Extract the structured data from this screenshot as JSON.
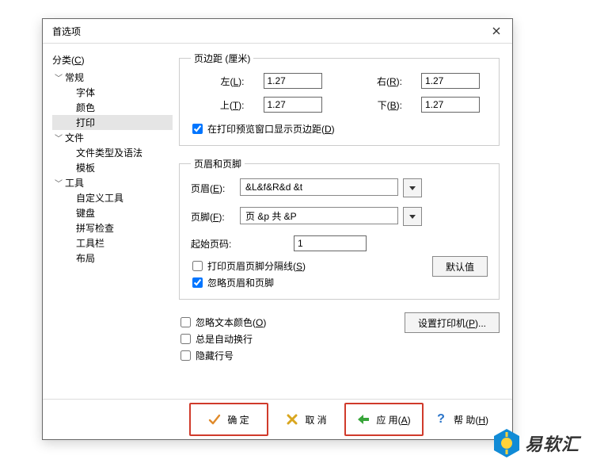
{
  "dialog": {
    "title": "首选项"
  },
  "sidebar": {
    "category_label": "分类(",
    "category_key": "C",
    "category_label_end": ")",
    "groups": [
      {
        "label": "常规",
        "items": [
          "字体",
          "颜色",
          "打印"
        ],
        "selected_index": 2
      },
      {
        "label": "文件",
        "items": [
          "文件类型及语法",
          "模板"
        ],
        "selected_index": -1
      },
      {
        "label": "工具",
        "items": [
          "自定义工具",
          "键盘",
          "拼写检查",
          "工具栏",
          "布局"
        ],
        "selected_index": -1
      }
    ]
  },
  "margins": {
    "group_title": "页边距 (厘米)",
    "left_label": "左(",
    "left_key": "L",
    "left_end": "):",
    "left_value": "1.27",
    "right_label": "右(",
    "right_key": "R",
    "right_end": "):",
    "right_value": "1.27",
    "top_label": "上(",
    "top_key": "T",
    "top_end": "):",
    "top_value": "1.27",
    "bottom_label": "下(",
    "bottom_key": "B",
    "bottom_end": "):",
    "bottom_value": "1.27",
    "show_in_preview_checked": true,
    "show_in_preview_label": "在打印预览窗口显示页边距(",
    "show_in_preview_key": "D",
    "show_in_preview_end": ")"
  },
  "headerfooter": {
    "group_title": "页眉和页脚",
    "header_label": "页眉(",
    "header_key": "E",
    "header_end": "):",
    "header_value": "&L&f&R&d &t",
    "footer_label": "页脚(",
    "footer_key": "F",
    "footer_end": "):",
    "footer_value": "页 &p 共 &P",
    "start_page_label": "起始页码:",
    "start_page_value": "1",
    "separator_checked": false,
    "separator_label": "打印页眉页脚分隔线(",
    "separator_key": "S",
    "separator_end": ")",
    "ignore_checked": true,
    "ignore_label": "忽略页眉和页脚",
    "default_btn": "默认值"
  },
  "extra": {
    "ignore_color_checked": false,
    "ignore_color_label": "忽略文本颜色(",
    "ignore_color_key": "O",
    "ignore_color_end": ")",
    "wrap_checked": false,
    "wrap_label": "总是自动换行",
    "hide_lineno_checked": false,
    "hide_lineno_label": "隐藏行号",
    "printer_btn_label": "设置打印机(",
    "printer_btn_key": "P",
    "printer_btn_end": ")..."
  },
  "footer": {
    "ok": "确 定",
    "cancel": "取 消",
    "apply_label": "应 用(",
    "apply_key": "A",
    "apply_end": ")",
    "help_label": "帮 助(",
    "help_key": "H",
    "help_end": ")"
  },
  "brand": {
    "text": "易软汇"
  }
}
